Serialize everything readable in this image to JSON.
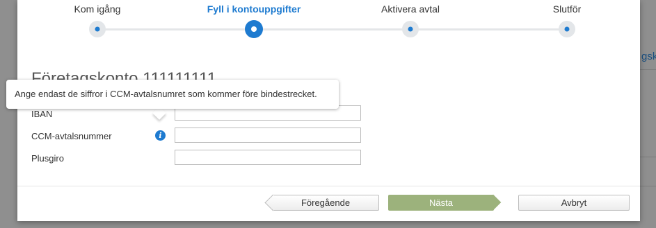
{
  "stepper": {
    "steps": [
      {
        "label": "Kom igång"
      },
      {
        "label": "Fyll i kontouppgifter"
      },
      {
        "label": "Aktivera avtal"
      },
      {
        "label": "Slutför"
      }
    ],
    "active_step": 2
  },
  "background": {
    "partial_text": "gsk"
  },
  "form": {
    "title": "Företagskonto 111111111",
    "tooltip": "Ange endast de siffror i CCM-avtalsnumret som kommer före bindestrecket.",
    "fields": [
      {
        "label": "IBAN",
        "value": ""
      },
      {
        "label": "CCM-avtalsnummer",
        "value": ""
      },
      {
        "label": "Plusgiro",
        "value": ""
      }
    ],
    "info_icon_glyph": "i"
  },
  "footer": {
    "prev_label": "Föregående",
    "next_label": "Nästa",
    "cancel_label": "Avbryt"
  },
  "colors": {
    "accent": "#1e7bd0",
    "next_button": "#9cb27c"
  }
}
